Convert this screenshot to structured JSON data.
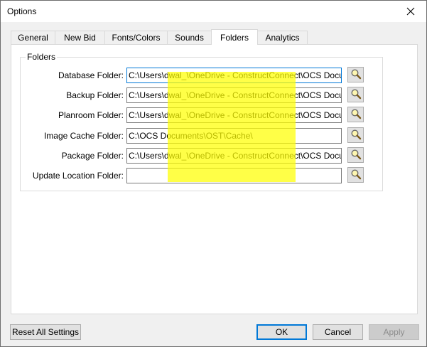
{
  "window": {
    "title": "Options",
    "close_icon": "close-icon"
  },
  "tabs": [
    {
      "label": "General"
    },
    {
      "label": "New Bid"
    },
    {
      "label": "Fonts/Colors"
    },
    {
      "label": "Sounds"
    },
    {
      "label": "Folders",
      "selected": true
    },
    {
      "label": "Analytics"
    }
  ],
  "folders": {
    "group_title": "Folders",
    "rows": [
      {
        "label": "Database Folder:",
        "value": "C:\\Users\\dwal_\\OneDrive - ConstructConnect\\OCS Documents\\",
        "icon": "magnifier-icon"
      },
      {
        "label": "Backup Folder:",
        "value": "C:\\Users\\dwal_\\OneDrive - ConstructConnect\\OCS Documents\\",
        "icon": "magnifier-icon"
      },
      {
        "label": "Planroom Folder:",
        "value": "C:\\Users\\dwal_\\OneDrive - ConstructConnect\\OCS Documents\\",
        "icon": "magnifier-icon"
      },
      {
        "label": "Image Cache Folder:",
        "value": "C:\\OCS Documents\\OST\\Cache\\",
        "icon": "magnifier-icon"
      },
      {
        "label": "Package Folder:",
        "value": "C:\\Users\\dwal_\\OneDrive - ConstructConnect\\OCS Documents\\",
        "icon": "magnifier-icon"
      },
      {
        "label": "Update Location Folder:",
        "value": "",
        "icon": "magnifier-icon"
      }
    ],
    "highlight_color": "#ffff00"
  },
  "buttons": {
    "reset": "Reset All Settings",
    "ok": "OK",
    "cancel": "Cancel",
    "apply": "Apply"
  },
  "colors": {
    "focus_border": "#0078d7",
    "dialog_bg": "#f0f0f0"
  }
}
